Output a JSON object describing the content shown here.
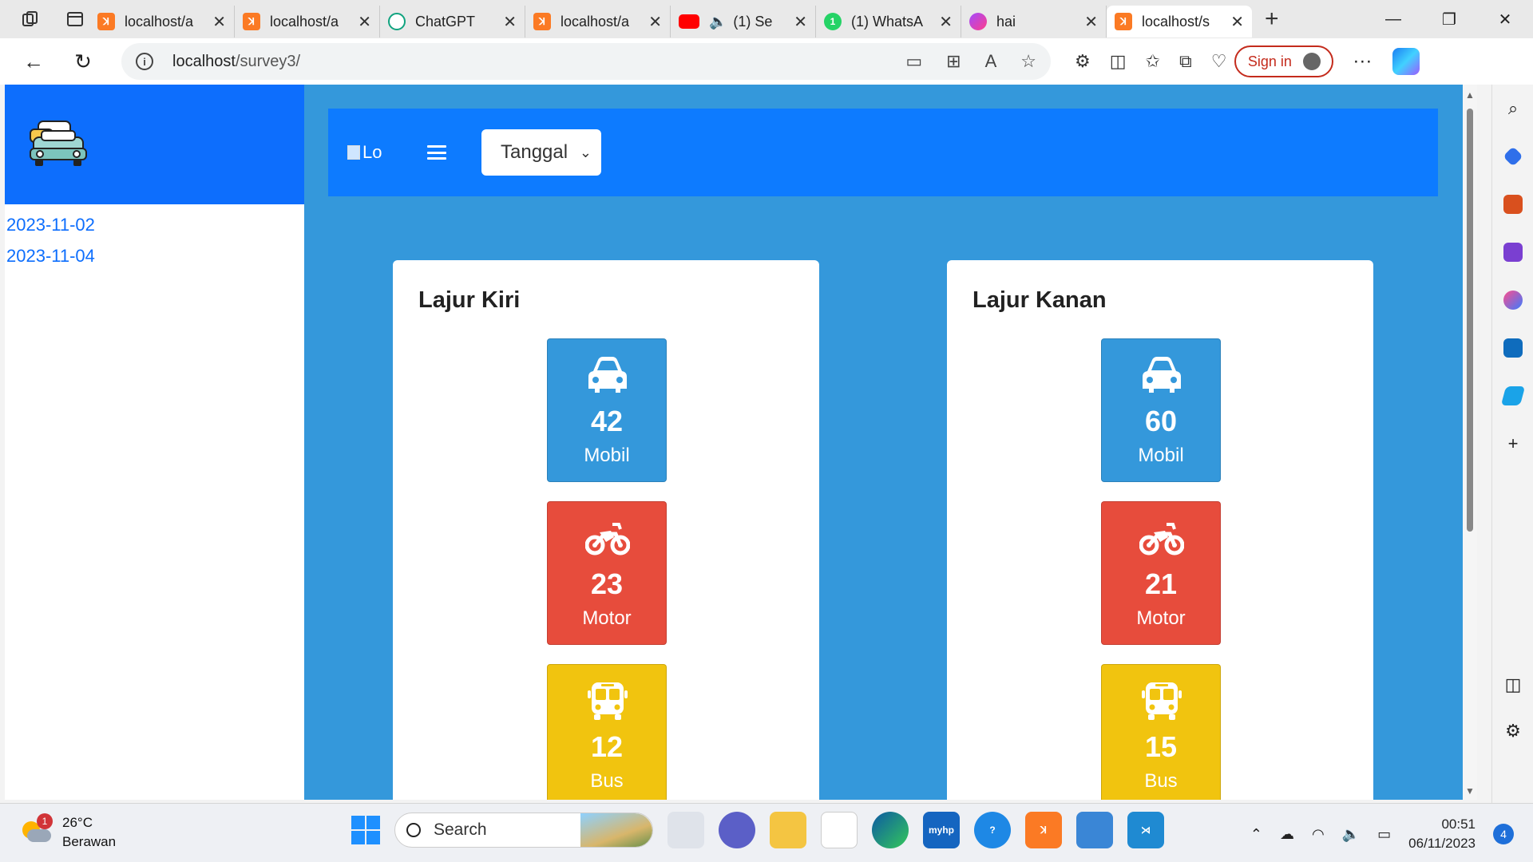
{
  "browser": {
    "tabs": [
      {
        "title": "localhost/a",
        "icon": "xampp-icon"
      },
      {
        "title": "localhost/a",
        "icon": "xampp-icon"
      },
      {
        "title": "ChatGPT",
        "icon": "chatgpt-icon"
      },
      {
        "title": "localhost/a",
        "icon": "xampp-icon"
      },
      {
        "title": "(1) Se",
        "icon": "youtube-icon"
      },
      {
        "title": "(1) WhatsA",
        "icon": "whatsapp-icon"
      },
      {
        "title": "hai",
        "icon": "hai-icon"
      },
      {
        "title": "localhost/s",
        "icon": "xampp-icon",
        "active": true
      }
    ],
    "whatsapp_badge": "1",
    "url_host": "localhost",
    "url_path": "/survey3/",
    "sign_in_label": "Sign in",
    "accent_color": "#c42b1c"
  },
  "page": {
    "sidebar_dates": [
      "2023-11-02",
      "2023-11-04"
    ],
    "logo_alt": "Lo",
    "date_select": {
      "selected": "Tanggal"
    },
    "colors": {
      "primary": "#0d6efd",
      "background": "#3498db",
      "mobil": "#3498db",
      "motor": "#e74c3c",
      "bus": "#f1c40f"
    },
    "lanes": [
      {
        "title": "Lajur Kiri",
        "counts": {
          "mobil": "42",
          "motor": "23",
          "bus": "12"
        }
      },
      {
        "title": "Lajur Kanan",
        "counts": {
          "mobil": "60",
          "motor": "21",
          "bus": "15"
        }
      }
    ],
    "labels": {
      "mobil": "Mobil",
      "motor": "Motor",
      "bus": "Bus"
    }
  },
  "taskbar": {
    "temperature": "26°C",
    "weather": "Berawan",
    "weather_badge": "1",
    "search_label": "Search",
    "time": "00:51",
    "date": "06/11/2023",
    "notifications": "4"
  }
}
